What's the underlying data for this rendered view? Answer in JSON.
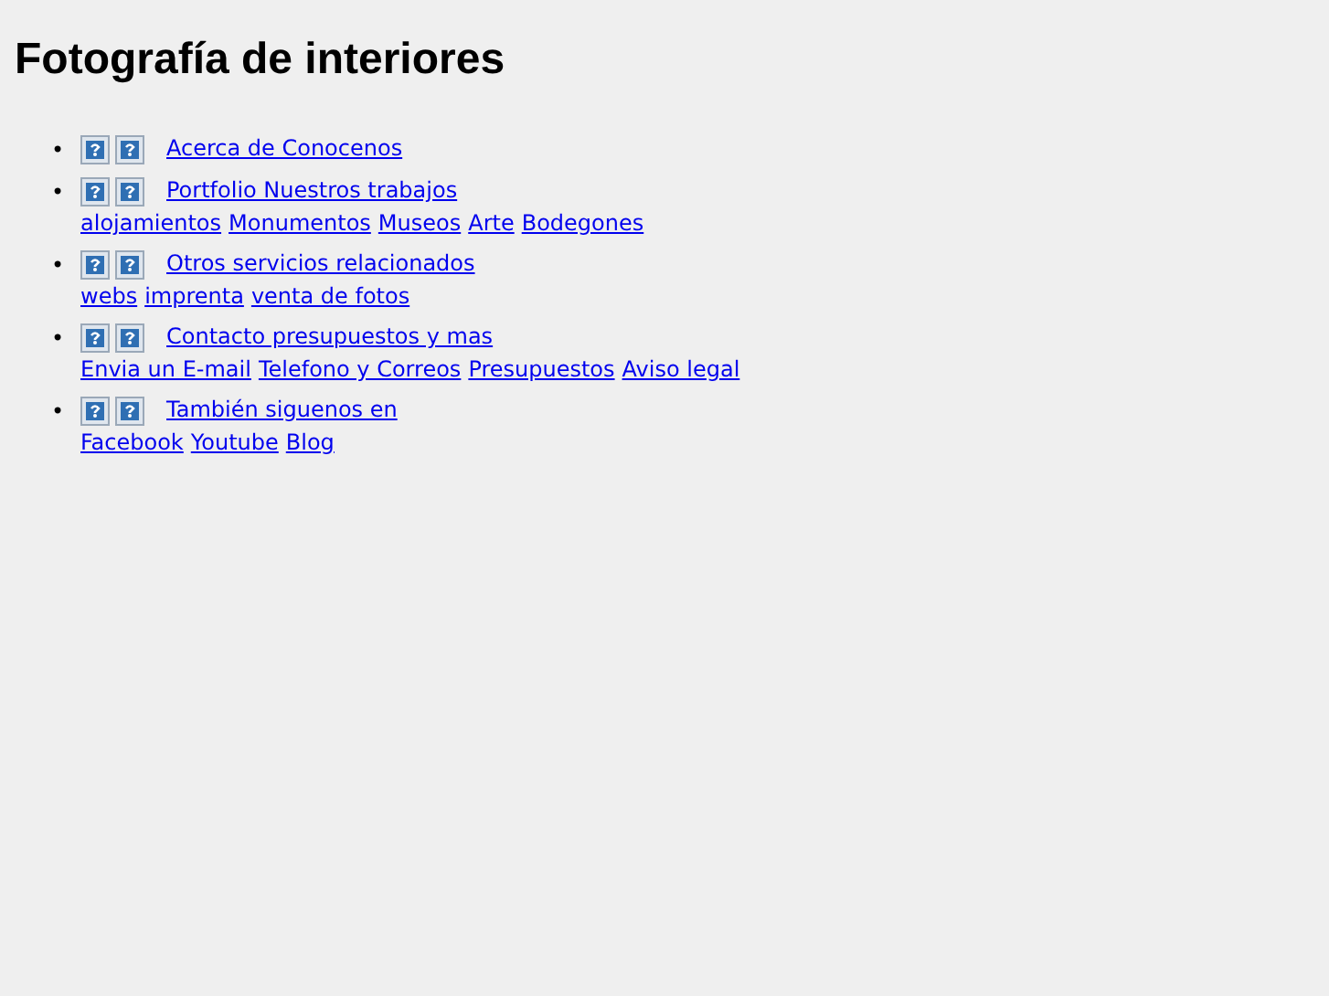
{
  "title": "Fotografía de interiores",
  "menu": [
    {
      "marker": "•",
      "label": "Acerca de Conocenos"
    },
    {
      "marker": "•",
      "label": "Portfolio Nuestros trabajos",
      "links": [
        "alojamientos",
        "Monumentos",
        "Museos",
        "Arte",
        "Bodegones"
      ]
    },
    {
      "marker": "•",
      "label": "Otros servicios relacionados",
      "links": [
        "webs",
        "imprenta",
        "venta de fotos"
      ]
    },
    {
      "marker": "•",
      "label": "Contacto presupuestos y mas",
      "links": [
        "Envia un E-mail",
        "Telefono y Correos",
        "Presupuestos",
        "Aviso legal"
      ]
    },
    {
      "marker": "•",
      "label": "También siguenos en",
      "links": [
        "Facebook",
        "Youtube",
        "Blog"
      ]
    }
  ]
}
